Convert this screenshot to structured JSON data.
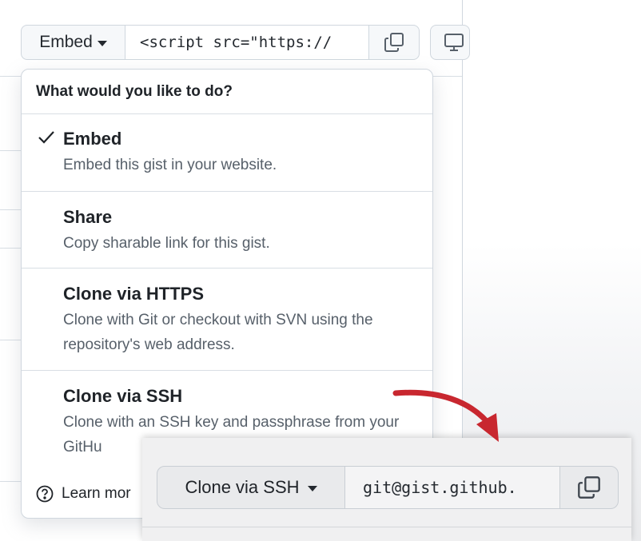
{
  "toolbar": {
    "embed_label": "Embed",
    "url_value": "<script src=\"https://",
    "copy_icon": "copy-icon",
    "desktop_icon": "desktop-icon"
  },
  "menu": {
    "header": "What would you like to do?",
    "items": [
      {
        "title": "Embed",
        "desc": "Embed this gist in your website.",
        "selected": true
      },
      {
        "title": "Share",
        "desc": "Copy sharable link for this gist.",
        "selected": false
      },
      {
        "title": "Clone via HTTPS",
        "desc": "Clone with Git or checkout with SVN using the repository's web address.",
        "selected": false
      },
      {
        "title": "Clone via SSH",
        "desc": "Clone with an SSH key and passphrase from your GitHu",
        "selected": false
      }
    ],
    "footer_label": "Learn mor"
  },
  "inset": {
    "button_label": "Clone via SSH",
    "field_value": "git@gist.github."
  },
  "colors": {
    "arrow": "#c8272f",
    "border": "#d0d7de",
    "muted_text": "#57606a"
  }
}
